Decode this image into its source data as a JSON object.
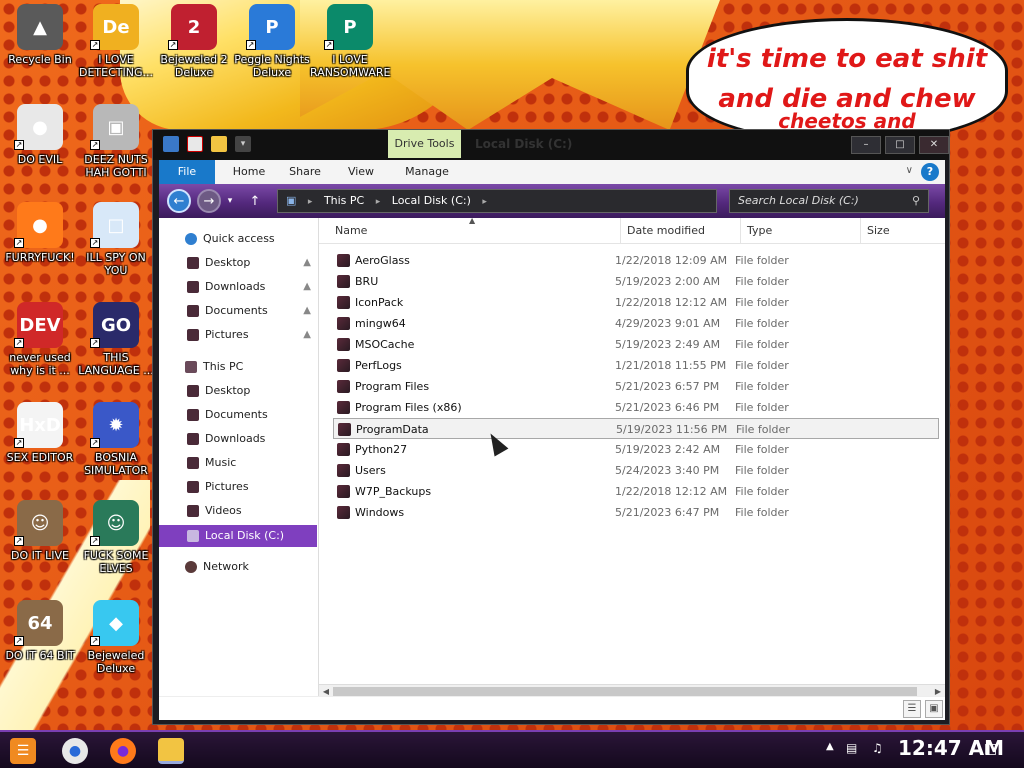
{
  "wallpaper": {
    "speech_lines": [
      "it's time to eat shit",
      "and die and chew",
      "cheetos and"
    ]
  },
  "desktop_icons": [
    {
      "label": "Recycle Bin",
      "icon": "recycle-bin-icon",
      "glyph": "▲",
      "color": "#5a5a5a"
    },
    {
      "label": "I LOVE DETECTING...",
      "icon": "de-app-icon",
      "glyph": "De",
      "color": "#f0b020"
    },
    {
      "label": "Bejeweled 2 Deluxe",
      "icon": "bejeweled-2-icon",
      "glyph": "2",
      "color": "#c02030"
    },
    {
      "label": "Peggle Nights Deluxe",
      "icon": "peggle-icon",
      "glyph": "P",
      "color": "#2a7ad8"
    },
    {
      "label": "I LOVE RANSOMWARE",
      "icon": "publisher-icon",
      "glyph": "P",
      "color": "#0b8a6a"
    },
    {
      "label": "DO EVIL",
      "icon": "chrome-icon",
      "glyph": "●",
      "color": "#e8e8e8"
    },
    {
      "label": "DEEZ NUTS HAH GOTTI",
      "icon": "windows-copy-icon",
      "glyph": "▣",
      "color": "#b8b8b8"
    },
    {
      "label": "FURRYFUCK!",
      "icon": "firefox-icon",
      "glyph": "●",
      "color": "#ff7a1a"
    },
    {
      "label": "ILL SPY ON YOU",
      "icon": "remote-desktop-icon",
      "glyph": "□",
      "color": "#d8e8f8"
    },
    {
      "label": "never used why is it ...",
      "icon": "dev-cpp-icon",
      "glyph": "DEV",
      "color": "#d02828"
    },
    {
      "label": "THIS LANGUAGE ...",
      "icon": "goland-icon",
      "glyph": "GO",
      "color": "#2a2a6a"
    },
    {
      "label": "SEX EDITOR",
      "icon": "hxd-icon",
      "glyph": "HxD",
      "color": "#f4f4f4"
    },
    {
      "label": "BOSNIA SIMULATOR",
      "icon": "mine-icon",
      "glyph": "✹",
      "color": "#3a58c8"
    },
    {
      "label": "DO IT LIVE",
      "icon": "portrait-icon",
      "glyph": "☺",
      "color": "#8a6a48"
    },
    {
      "label": "FUCK SOME ELVES",
      "icon": "santa-icon",
      "glyph": "☺",
      "color": "#2a7a5a"
    },
    {
      "label": "DO IT 64 BIT",
      "icon": "portrait-64-icon",
      "glyph": "64",
      "color": "#8a6a48"
    },
    {
      "label": "Bejeweled Deluxe",
      "icon": "diamond-icon",
      "glyph": "◆",
      "color": "#38c8f0"
    }
  ],
  "window": {
    "title": "Local Disk (C:)",
    "context_tab": "Drive Tools",
    "controls": {
      "minimize": "–",
      "maximize": "□",
      "close": "✕"
    },
    "ribbon_tabs": [
      "File",
      "Home",
      "Share",
      "View",
      "Manage"
    ],
    "help": "?",
    "address": [
      "This PC",
      "Local Disk (C:)"
    ],
    "search_placeholder": "Search Local Disk (C:)",
    "columns": [
      "Name",
      "Date modified",
      "Type",
      "Size"
    ],
    "nav": {
      "quick_access": "Quick access",
      "quick_items": [
        "Desktop",
        "Downloads",
        "Documents",
        "Pictures"
      ],
      "this_pc": "This PC",
      "pc_items": [
        "Desktop",
        "Documents",
        "Downloads",
        "Music",
        "Pictures",
        "Videos",
        "Local Disk (C:)"
      ],
      "network": "Network"
    },
    "files": [
      {
        "name": "AeroGlass",
        "date": "1/22/2018 12:09 AM",
        "type": "File folder"
      },
      {
        "name": "BRU",
        "date": "5/19/2023 2:00 AM",
        "type": "File folder"
      },
      {
        "name": "IconPack",
        "date": "1/22/2018 12:12 AM",
        "type": "File folder"
      },
      {
        "name": "mingw64",
        "date": "4/29/2023 9:01 AM",
        "type": "File folder"
      },
      {
        "name": "MSOCache",
        "date": "5/19/2023 2:49 AM",
        "type": "File folder"
      },
      {
        "name": "PerfLogs",
        "date": "1/21/2018 11:55 PM",
        "type": "File folder"
      },
      {
        "name": "Program Files",
        "date": "5/21/2023 6:57 PM",
        "type": "File folder"
      },
      {
        "name": "Program Files (x86)",
        "date": "5/21/2023 6:46 PM",
        "type": "File folder"
      },
      {
        "name": "ProgramData",
        "date": "5/19/2023 11:56 PM",
        "type": "File folder"
      },
      {
        "name": "Python27",
        "date": "5/19/2023 2:42 AM",
        "type": "File folder"
      },
      {
        "name": "Users",
        "date": "5/24/2023 3:40 PM",
        "type": "File folder"
      },
      {
        "name": "W7P_Backups",
        "date": "1/22/2018 12:12 AM",
        "type": "File folder"
      },
      {
        "name": "Windows",
        "date": "5/21/2023 6:47 PM",
        "type": "File folder"
      }
    ],
    "hovered_file": "ProgramData"
  },
  "taskbar": {
    "clock": "12:47 AM"
  },
  "colors": {
    "accent_purple": "#7f3fbf",
    "file_tab_blue": "#1979ca",
    "speech_red": "#e01818"
  }
}
